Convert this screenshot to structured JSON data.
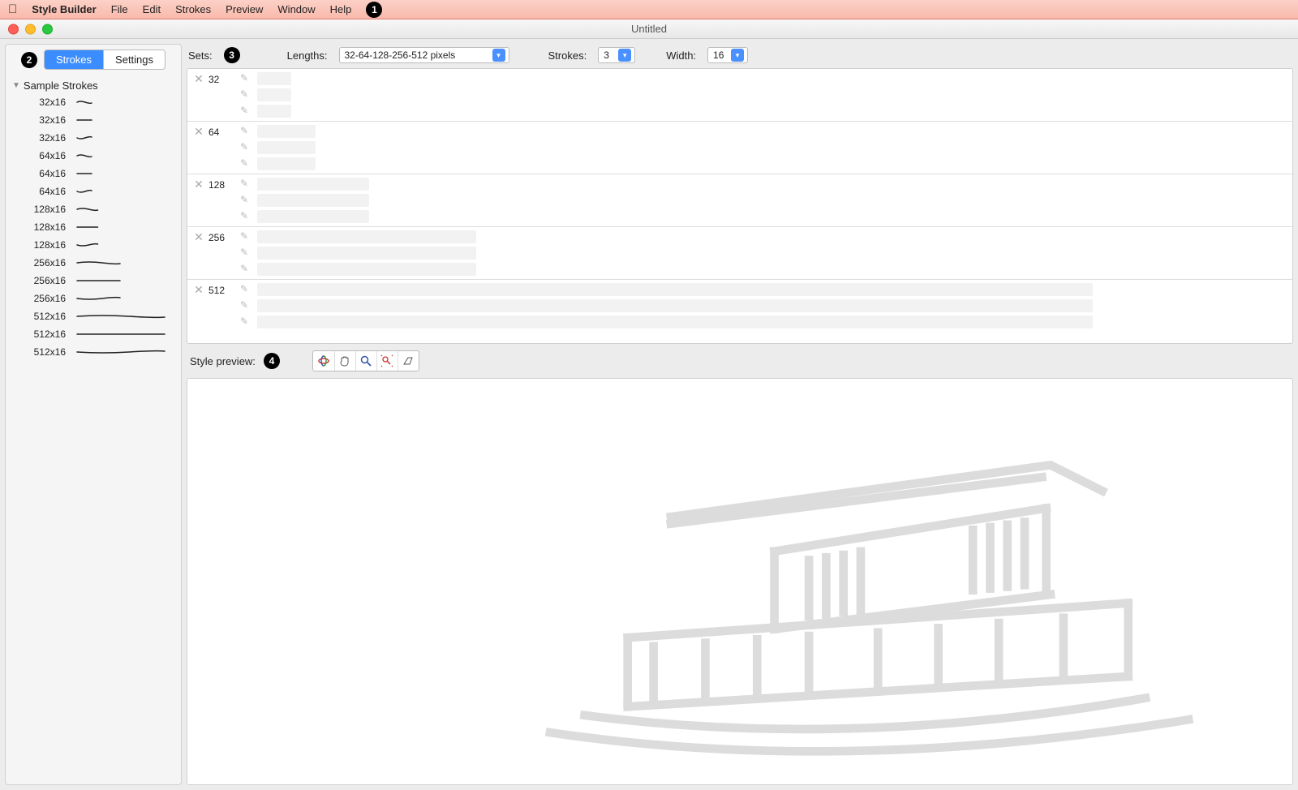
{
  "menubar": {
    "app_name": "Style Builder",
    "items": [
      "File",
      "Edit",
      "Strokes",
      "Preview",
      "Window",
      "Help"
    ],
    "callout": "1"
  },
  "window": {
    "title": "Untitled"
  },
  "sidebar": {
    "callout": "2",
    "tabs": {
      "strokes": "Strokes",
      "settings": "Settings"
    },
    "group_title": "Sample Strokes",
    "items": [
      {
        "dim": "32x16",
        "len": 32
      },
      {
        "dim": "32x16",
        "len": 32
      },
      {
        "dim": "32x16",
        "len": 32
      },
      {
        "dim": "64x16",
        "len": 64
      },
      {
        "dim": "64x16",
        "len": 64
      },
      {
        "dim": "64x16",
        "len": 64
      },
      {
        "dim": "128x16",
        "len": 128
      },
      {
        "dim": "128x16",
        "len": 128
      },
      {
        "dim": "128x16",
        "len": 128
      },
      {
        "dim": "256x16",
        "len": 256
      },
      {
        "dim": "256x16",
        "len": 256
      },
      {
        "dim": "256x16",
        "len": 256
      },
      {
        "dim": "512x16",
        "len": 512
      },
      {
        "dim": "512x16",
        "len": 512
      },
      {
        "dim": "512x16",
        "len": 512
      }
    ]
  },
  "sets": {
    "callout": "3",
    "label": "Sets:",
    "lengths_label": "Lengths:",
    "lengths_value": "32-64-128-256-512 pixels",
    "strokes_label": "Strokes:",
    "strokes_value": "3",
    "width_label": "Width:",
    "width_value": "16",
    "rows": [
      {
        "len": "32"
      },
      {
        "len": "64"
      },
      {
        "len": "128"
      },
      {
        "len": "256"
      },
      {
        "len": "512"
      }
    ]
  },
  "preview": {
    "callout": "4",
    "label": "Style preview:",
    "tools": [
      "orbit-icon",
      "hand-icon",
      "zoom-icon",
      "zoom-extents-icon",
      "clear-icon"
    ]
  }
}
